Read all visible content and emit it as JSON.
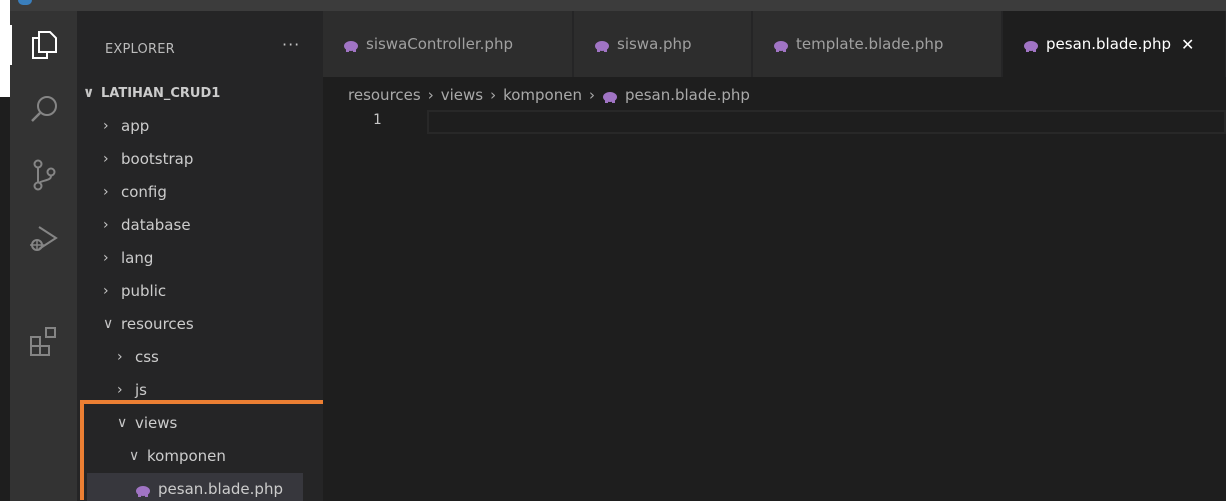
{
  "sidebar": {
    "title": "EXPLORER",
    "more_actions": "···",
    "tree": [
      {
        "chevron": "∨",
        "label": "LATIHAN_CRUD1"
      },
      {
        "chevron": "›",
        "label": "app"
      },
      {
        "chevron": "›",
        "label": "bootstrap"
      },
      {
        "chevron": "›",
        "label": "config"
      },
      {
        "chevron": "›",
        "label": "database"
      },
      {
        "chevron": "›",
        "label": "lang"
      },
      {
        "chevron": "›",
        "label": "public"
      },
      {
        "chevron": "∨",
        "label": "resources"
      },
      {
        "chevron": "›",
        "label": "css"
      },
      {
        "chevron": "›",
        "label": "js"
      },
      {
        "chevron": "∨",
        "label": "views"
      },
      {
        "chevron": "∨",
        "label": "komponen"
      },
      {
        "chevron": "",
        "label": "pesan.blade.php",
        "icon": "php-elephant-icon"
      }
    ]
  },
  "tabs": [
    {
      "label": "siswaController.php",
      "icon": "php-elephant-icon"
    },
    {
      "label": "siswa.php",
      "icon": "php-elephant-icon"
    },
    {
      "label": "template.blade.php",
      "icon": "php-elephant-icon"
    },
    {
      "label": "pesan.blade.php",
      "icon": "php-elephant-icon",
      "active": true,
      "close": "✕"
    }
  ],
  "breadcrumb": {
    "items": [
      "resources",
      "views",
      "komponen",
      "pesan.blade.php"
    ],
    "separator": "›"
  },
  "editor": {
    "line_number": "1"
  },
  "colors": {
    "php_icon": "#a074c4",
    "highlight": "#ec7f33",
    "activity_bar": "#333333",
    "sidebar": "#252526",
    "editor": "#1e1e1e"
  },
  "activity_icons": [
    "explorer-files-icon",
    "search-icon",
    "source-control-icon",
    "run-debug-icon",
    "extensions-icon"
  ]
}
